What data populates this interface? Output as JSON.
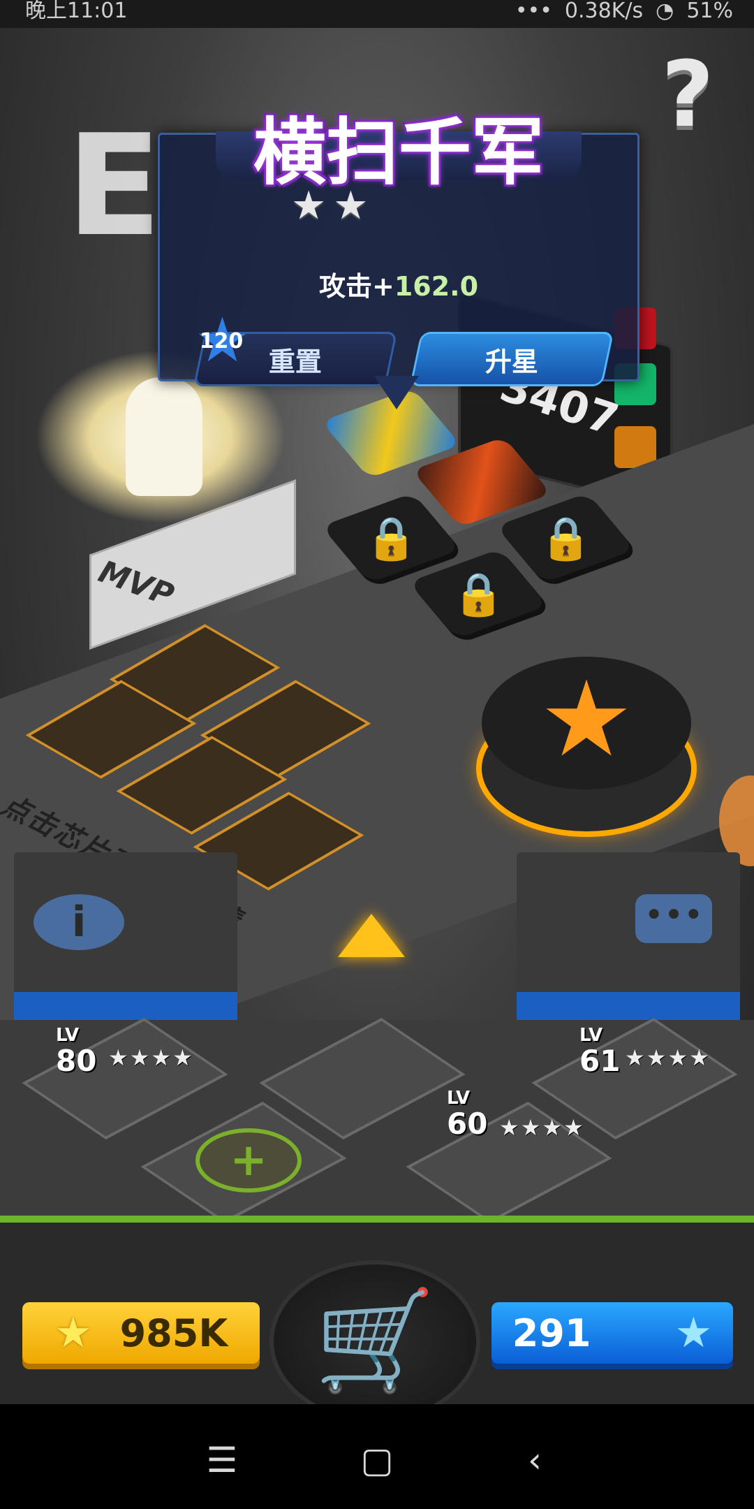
{
  "status_bar": {
    "time": "晚上11:01",
    "dots": "•••",
    "speed": "0.38K/s",
    "battery": "51%"
  },
  "panel": {
    "title": "横扫千军",
    "stars": [
      "★",
      "★"
    ],
    "attack_label": "攻击+",
    "attack_value": "162.0",
    "level": "120",
    "reset_label": "重置",
    "upgrade_label": "升星"
  },
  "board": {
    "power": "3407",
    "pedestal_label": "MVP",
    "hint": "点击芯片可查看详情",
    "lock_icon": "lock-icon",
    "chips": [
      "RDK chip",
      "fire chip"
    ]
  },
  "team": [
    {
      "lv_label": "LV",
      "level": "80",
      "stars": "★★★★"
    },
    {
      "lv_label": "LV",
      "level": "61",
      "stars": "★★★★"
    },
    {
      "lv_label": "LV",
      "level": "60",
      "stars": "★★★★"
    }
  ],
  "currency": {
    "gold": "985K",
    "gems": "291"
  },
  "colors": {
    "accent_gold": "#ffa800",
    "accent_blue": "#1b5fc2",
    "title_glow": "#9a3bd8"
  }
}
